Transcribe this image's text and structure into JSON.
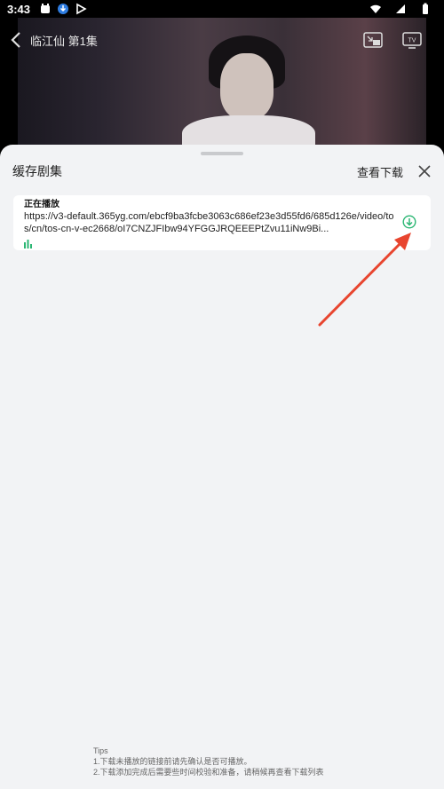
{
  "status_bar": {
    "time": "3:43"
  },
  "video": {
    "title": "临江仙 第1集"
  },
  "sheet": {
    "title": "缓存剧集",
    "view_downloads": "查看下载"
  },
  "episode": {
    "status": "正在播放",
    "url": "https://v3-default.365yg.com/ebcf9ba3fcbe3063c686ef23e3d55fd6/685d126e/video/tos/cn/tos-cn-v-ec2668/oI7CNZJFIbw94YFGGJRQEEEPtZvu11iNw9Bi..."
  },
  "tips": {
    "heading": "Tips",
    "line1": "1.下载未播放的链接前请先确认是否可播放。",
    "line2": "2.下载添加完成后需要些时间校验和准备，请稍候再查看下载列表"
  },
  "colors": {
    "accent_green": "#2bb673",
    "annotation_red": "#e8452f",
    "sheet_bg": "#f2f3f5"
  },
  "icons": [
    "back-arrow-icon",
    "pip-icon",
    "tv-cast-icon",
    "close-icon",
    "download-icon",
    "playing-bars-icon"
  ]
}
